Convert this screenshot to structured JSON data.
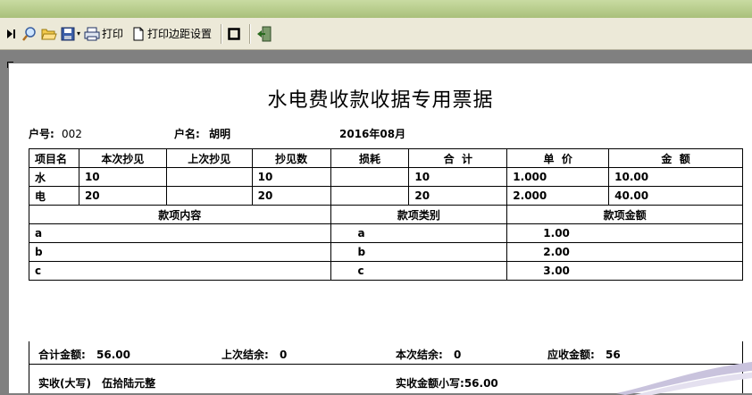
{
  "toolbar": {
    "print_label": "打印",
    "margin_label": "打印边距设置"
  },
  "receipt": {
    "title": "水电费收款收据专用票据",
    "account_no_label": "户号:",
    "account_no": "002",
    "name_label": "户名:",
    "name": "胡明",
    "period": "2016年08月",
    "headers": [
      "项目名",
      "本次抄见",
      "上次抄见",
      "抄见数",
      "损耗",
      "合  计",
      "单  价",
      "金  额"
    ],
    "rows": [
      {
        "item": "水",
        "current": "10",
        "previous": "",
        "reading": "10",
        "loss": "",
        "total": "10",
        "unit_price": "1.000",
        "amount": "10.00"
      },
      {
        "item": "电",
        "current": "20",
        "previous": "",
        "reading": "20",
        "loss": "",
        "total": "20",
        "unit_price": "2.000",
        "amount": "40.00"
      }
    ],
    "fee_headers": [
      "款项内容",
      "款项类别",
      "款项金额"
    ],
    "fees": [
      {
        "content": "a",
        "category": "a",
        "amount": "1.00"
      },
      {
        "content": "b",
        "category": "b",
        "amount": "2.00"
      },
      {
        "content": "c",
        "category": "c",
        "amount": "3.00"
      }
    ],
    "total_amount_label": "合计金额:",
    "total_amount": "56.00",
    "prev_balance_label": "上次结余:",
    "prev_balance": "0",
    "curr_balance_label": "本次结余:",
    "curr_balance": "0",
    "due_label": "应收金额:",
    "due": "56",
    "received_upper_label": "实收(大写)",
    "received_upper": "伍拾陆元整",
    "received_lower_label": "实收金额小写:",
    "received_lower": "56.00"
  }
}
